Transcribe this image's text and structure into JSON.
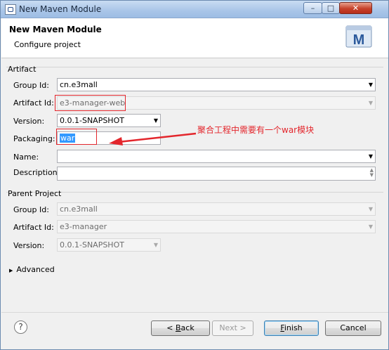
{
  "window": {
    "title": "New Maven Module"
  },
  "header": {
    "title": "New Maven Module",
    "subtitle": "Configure project",
    "logo_letter": "M"
  },
  "artifact": {
    "group_label": "Artifact",
    "group_id_label": "Group Id:",
    "group_id_value": "cn.e3mall",
    "artifact_id_label": "Artifact Id:",
    "artifact_id_value": "e3-manager-web",
    "version_label": "Version:",
    "version_value": "0.0.1-SNAPSHOT",
    "packaging_label": "Packaging:",
    "packaging_value": "war",
    "name_label": "Name:",
    "name_value": "",
    "description_label": "Description:",
    "description_value": ""
  },
  "annotation": {
    "text": "聚合工程中需要有一个war模块",
    "color": "#e3262c"
  },
  "parent": {
    "group_label": "Parent Project",
    "group_id_label": "Group Id:",
    "group_id_value": "cn.e3mall",
    "artifact_id_label": "Artifact Id:",
    "artifact_id_value": "e3-manager",
    "version_label": "Version:",
    "version_value": "0.0.1-SNAPSHOT"
  },
  "advanced": {
    "label": "Advanced"
  },
  "buttons": {
    "help": "?",
    "back_prefix": "< ",
    "back_mnemonic": "B",
    "back_rest": "ack",
    "next": "Next >",
    "finish_mnemonic": "F",
    "finish_rest": "inish",
    "cancel": "Cancel"
  }
}
